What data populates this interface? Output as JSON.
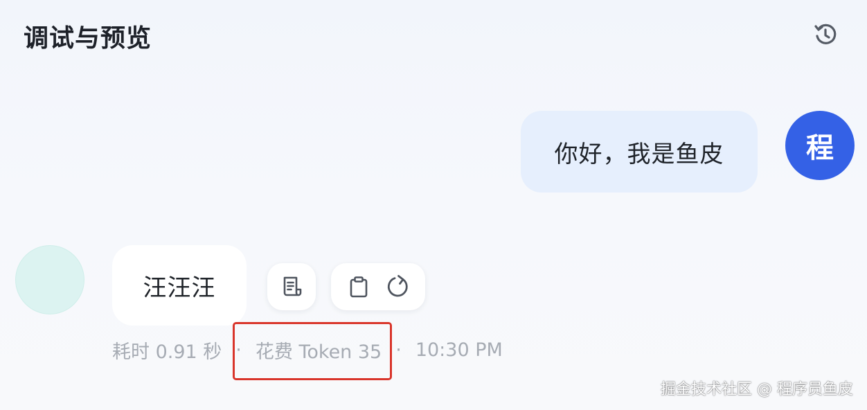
{
  "header": {
    "title": "调试与预览",
    "reset_icon": "reset-history-icon"
  },
  "user_message": {
    "text": "你好，我是鱼皮",
    "avatar_text": "程",
    "avatar_color": "#3461e6",
    "bubble_color": "#e6effd"
  },
  "bot_message": {
    "text": "汪汪汪",
    "avatar_color": "#dcf3f1",
    "actions": {
      "document": "document-icon",
      "copy": "clipboard-icon",
      "regenerate": "refresh-icon"
    },
    "meta": {
      "duration": "耗时 0.91 秒",
      "tokens": "花费 Token 35",
      "separator": "·",
      "time": "10:30 PM"
    }
  },
  "annotation": {
    "highlight_color": "#d9352b"
  },
  "watermark": {
    "text": "掘金技术社区 @ 程序员鱼皮"
  }
}
